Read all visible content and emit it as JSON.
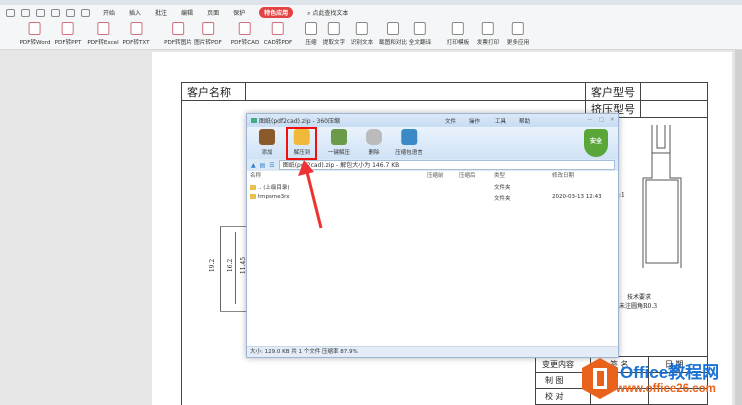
{
  "menu": {
    "items": [
      "开始",
      "插入",
      "批注",
      "编辑",
      "页面",
      "保护"
    ],
    "active": "特色应用",
    "search": "点此查找文本"
  },
  "tools": [
    "PDF转Word",
    "PDF转PPT",
    "PDF转Excel",
    "PDF转TXT",
    "PDF转图片",
    "图片转PDF",
    "PDF转CAD",
    "CAD转PDF",
    "压缩",
    "提取文字",
    "识别文本",
    "截图和对比",
    "全文翻译",
    "打印模板",
    "发票打印",
    "更多应用"
  ],
  "drawing": {
    "customer_name": "客户名称",
    "customer_model": "客户型号",
    "extrusion_model": "挤压型号",
    "dims": [
      "19.2",
      "16.2",
      "11.45"
    ],
    "scale_fragment": ":1",
    "tech_req": "技术要求",
    "tech_note": "未注圆角R0.3",
    "table": [
      "变更内容",
      "签 名",
      "日 期",
      "制 图",
      "校 对"
    ]
  },
  "dialog": {
    "title": "图纸(pdf2cad).zip - 360压缩",
    "menu": [
      "文件",
      "操作",
      "工具",
      "帮助"
    ],
    "toolbar": [
      "添加",
      "解压到",
      "一键解压",
      "删除",
      "压缩包语言"
    ],
    "shield": "安全",
    "address": "图纸(pdf2cad).zip - 解包大小为 146.7 KB",
    "columns": [
      "名称",
      "压缩前",
      "压缩后",
      "类型",
      "修改日期"
    ],
    "rows": [
      {
        "name": ".. (上级目录)",
        "type": "文件夹",
        "date": ""
      },
      {
        "name": "tmpsme3rx",
        "type": "文件夹",
        "date": "2020-03-13 12:43"
      }
    ],
    "status": "大小: 129.0 KB 共 1 个文件 压缩率 87.9%"
  },
  "watermark": {
    "brand": "Office教程网",
    "url": "www.office26.com"
  },
  "colors": {
    "accent": "#e24343",
    "highlight": "#e11111",
    "logo": "#e8621c"
  }
}
